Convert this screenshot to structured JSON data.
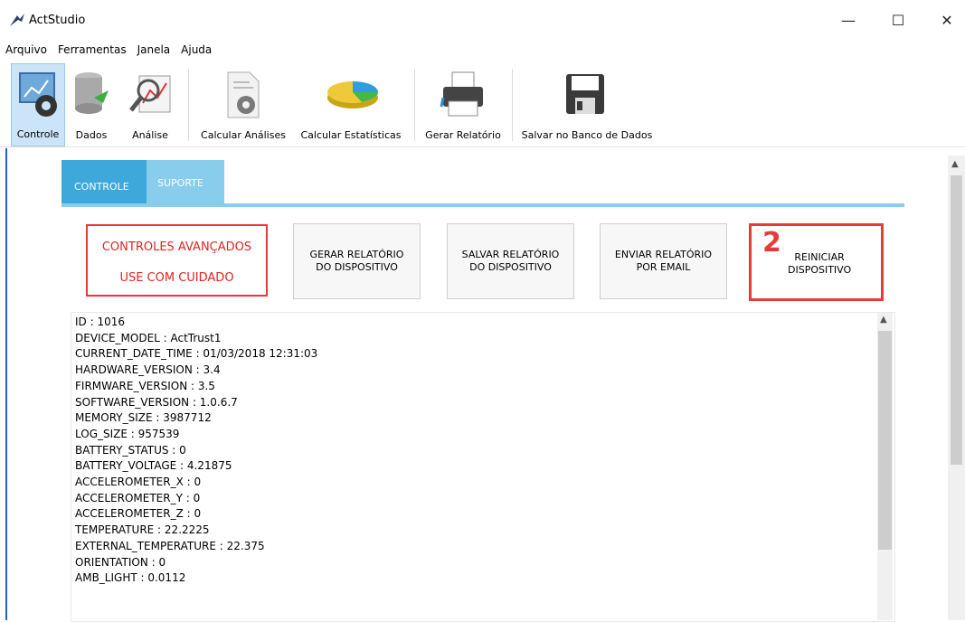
{
  "window": {
    "title": "ActStudio",
    "minimize": "—",
    "maximize": "☐",
    "close": "✕"
  },
  "menu": [
    "Arquivo",
    "Ferramentas",
    "Janela",
    "Ajuda"
  ],
  "toolbar": {
    "controle": "Controle",
    "dados": "Dados",
    "analise": "Análise",
    "calcular_analises": "Calcular Análises",
    "calcular_estatisticas": "Calcular Estatísticas",
    "gerar_relatorio": "Gerar Relatório",
    "salvar_banco": "Salvar no Banco de Dados"
  },
  "tabs": {
    "controle": "CONTROLE",
    "suporte": "SUPORTE"
  },
  "advanced": {
    "line1": "CONTROLES AVANÇADOS",
    "line2": "USE COM CUIDADO"
  },
  "buttons": {
    "gerar_line1": "GERAR RELATÓRIO",
    "gerar_line2": "DO DISPOSITIVO",
    "salvar_line1": "SALVAR RELATÓRIO",
    "salvar_line2": "DO DISPOSITIVO",
    "enviar_line1": "ENVIAR RELATÓRIO",
    "enviar_line2": "POR EMAIL",
    "reiniciar_number": "2",
    "reiniciar_line1": "REINICIAR",
    "reiniciar_line2": "DISPOSITIVO"
  },
  "info_lines": [
    "ID : 1016",
    "DEVICE_MODEL : ActTrust1",
    "CURRENT_DATE_TIME : 01/03/2018 12:31:03",
    "HARDWARE_VERSION : 3.4",
    "FIRMWARE_VERSION : 3.5",
    "SOFTWARE_VERSION : 1.0.6.7",
    "MEMORY_SIZE : 3987712",
    "LOG_SIZE : 957539",
    "BATTERY_STATUS : 0",
    "BATTERY_VOLTAGE : 4.21875",
    "ACCELEROMETER_X : 0",
    "ACCELEROMETER_Y : 0",
    "ACCELEROMETER_Z : 0",
    "TEMPERATURE : 22.2225",
    "EXTERNAL_TEMPERATURE : 22.375",
    "ORIENTATION : 0",
    "AMB_LIGHT : 0.0112"
  ],
  "colors": {
    "accent_blue": "#3fa8da",
    "light_blue": "#89cdec",
    "warning_red": "#e53b3b"
  }
}
